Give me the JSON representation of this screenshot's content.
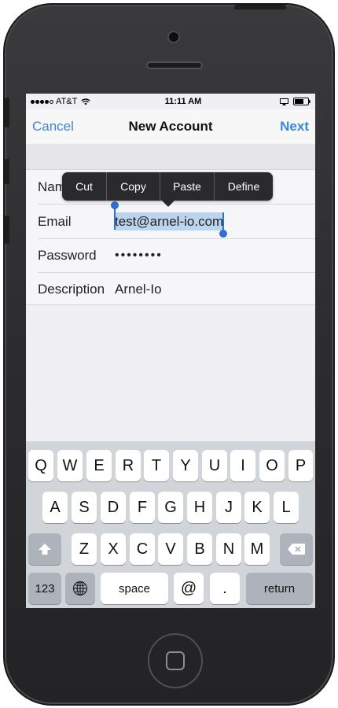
{
  "status_bar": {
    "carrier": "AT&T",
    "time": "11:11 AM"
  },
  "nav": {
    "cancel_label": "Cancel",
    "title": "New Account",
    "next_label": "Next"
  },
  "form": {
    "rows": [
      {
        "label": "Name",
        "value": ""
      },
      {
        "label": "Email",
        "value": "test@arnel-io.com"
      },
      {
        "label": "Password",
        "value": "••••••••"
      },
      {
        "label": "Description",
        "value": "Arnel-Io"
      }
    ],
    "name_label_visible": "Nam"
  },
  "edit_menu": {
    "items": [
      "Cut",
      "Copy",
      "Paste",
      "Define"
    ]
  },
  "keyboard": {
    "row1": [
      "Q",
      "W",
      "E",
      "R",
      "T",
      "Y",
      "U",
      "I",
      "O",
      "P"
    ],
    "row2": [
      "A",
      "S",
      "D",
      "F",
      "G",
      "H",
      "J",
      "K",
      "L"
    ],
    "row3": [
      "Z",
      "X",
      "C",
      "V",
      "B",
      "N",
      "M"
    ],
    "numbers_label": "123",
    "space_label": "space",
    "at_label": "@",
    "dot_label": ".",
    "return_label": "return"
  },
  "colors": {
    "accent": "#3a87d5",
    "selection": "#bcd5ee",
    "handle": "#2f6fd3"
  }
}
